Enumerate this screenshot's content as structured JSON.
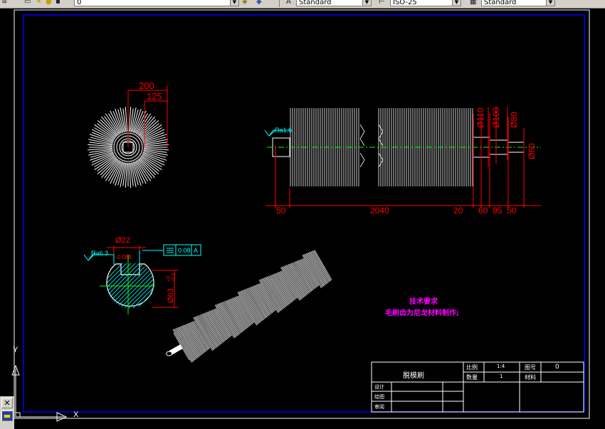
{
  "toolbar": {
    "layer_value": "0",
    "text_style": "Standard",
    "dim_style": "ISO-25",
    "table_style": "Standard",
    "icons": [
      "layer-icon",
      "layer-state-icon",
      "sun-icon",
      "layer-previous-icon",
      "text-style-icon",
      "dim-style-icon",
      "table-style-icon"
    ]
  },
  "dimensions": {
    "d200": "200",
    "d125": "125",
    "phi110": "Ø110",
    "phi100": "Ø100",
    "phi80": "Ø80",
    "phi60": "Ø60",
    "ra_main": "Ra1.6",
    "d50_left": "50",
    "d2040": "2040",
    "d20": "20",
    "d60": "60",
    "d95": "95",
    "d50_right": "50",
    "phi22": "Ø22",
    "tol22": "-0.088",
    "ra_section": "Ra6.3",
    "gdt_value": "0.08",
    "gdt_datum": "A",
    "phi63": "Ø63",
    "tol63_upper": "+0",
    "tol63_lower": "-0.2"
  },
  "notes": {
    "title": "技术要求",
    "line1": "毛刷齿为尼龙材料制作;"
  },
  "titleblock": {
    "name": "脱模刷",
    "scale_label": "比例",
    "scale_value": "1:4",
    "qty_label": "数量",
    "qty_value": "1",
    "drawno_label": "图号",
    "drawno_value": "0",
    "material_label": "材料",
    "design_label": "设计",
    "draw_label": "绘图",
    "check_label": "审阅"
  },
  "ucs": {
    "y": "Y",
    "x": "X"
  },
  "colors": {
    "background": "#000000",
    "dimension": "#ff0000",
    "annotation": "#00ffff",
    "note": "#ff00ff",
    "border": "#0000ff",
    "geometry": "#ffffff"
  }
}
